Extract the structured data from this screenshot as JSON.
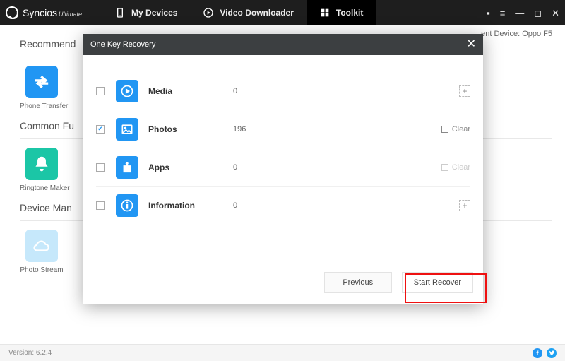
{
  "app": {
    "name": "Syncios",
    "edition": "Ultimate"
  },
  "tabs": {
    "devices": "My Devices",
    "video": "Video Downloader",
    "toolkit": "Toolkit"
  },
  "deviceStatus": {
    "prefix": "ent Device:",
    "name": "Oppo F5"
  },
  "sidebar": {
    "sections": {
      "recommend": "Recommend",
      "common": "Common Fu",
      "deviceMan": "Device Man"
    },
    "tiles": {
      "phoneTransfer": "Phone Transfer",
      "ringtone": "Ringtone Maker",
      "photoStream": "Photo Stream"
    }
  },
  "modal": {
    "title": "One Key Recovery",
    "rows": [
      {
        "key": "media",
        "label": "Media",
        "count": "0",
        "checked": false,
        "action": "add"
      },
      {
        "key": "photos",
        "label": "Photos",
        "count": "196",
        "checked": true,
        "action": "clear",
        "clearLabel": "Clear",
        "actionDisabled": false
      },
      {
        "key": "apps",
        "label": "Apps",
        "count": "0",
        "checked": false,
        "action": "clear",
        "clearLabel": "Clear",
        "actionDisabled": true
      },
      {
        "key": "info",
        "label": "Information",
        "count": "0",
        "checked": false,
        "action": "add"
      }
    ],
    "buttons": {
      "previous": "Previous",
      "start": "Start Recover"
    }
  },
  "status": {
    "versionLabel": "Version:",
    "version": "6.2.4"
  }
}
